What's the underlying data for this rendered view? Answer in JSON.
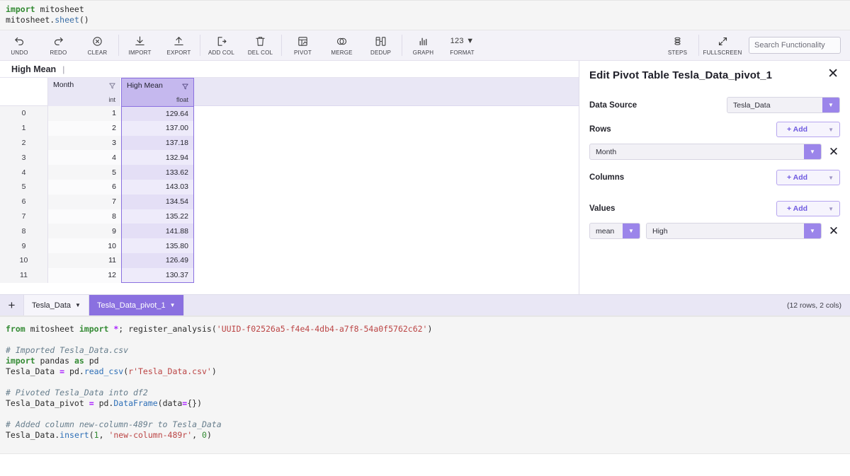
{
  "top_cell": {
    "line1_kw": "import",
    "line1_mod": " mitosheet",
    "line2_a": "mitosheet.",
    "line2_fn": "sheet",
    "line2_b": "()"
  },
  "toolbar": {
    "items": [
      {
        "label": "UNDO",
        "icon": "undo-icon"
      },
      {
        "label": "REDO",
        "icon": "redo-icon"
      },
      {
        "label": "CLEAR",
        "icon": "clear-icon"
      },
      {
        "label": "IMPORT",
        "icon": "import-icon"
      },
      {
        "label": "EXPORT",
        "icon": "export-icon"
      },
      {
        "label": "ADD COL",
        "icon": "add-column-icon"
      },
      {
        "label": "DEL COL",
        "icon": "delete-column-icon"
      },
      {
        "label": "PIVOT",
        "icon": "pivot-icon"
      },
      {
        "label": "MERGE",
        "icon": "merge-icon"
      },
      {
        "label": "DEDUP",
        "icon": "dedup-icon"
      },
      {
        "label": "GRAPH",
        "icon": "graph-icon"
      },
      {
        "label": "FORMAT",
        "icon": "format-number-icon",
        "icon_text": "123 ▼"
      },
      {
        "label": "STEPS",
        "icon": "steps-icon"
      },
      {
        "label": "FULLSCREEN",
        "icon": "fullscreen-icon"
      }
    ],
    "search_placeholder": "Search Functionality"
  },
  "formula_bar": {
    "cell_name": "High Mean"
  },
  "grid": {
    "columns": [
      {
        "name": "Month",
        "dtype": "int",
        "selected": false
      },
      {
        "name": "High Mean",
        "dtype": "float",
        "selected": true
      }
    ],
    "rows": [
      {
        "index": "0",
        "month": "1",
        "high_mean": "129.64"
      },
      {
        "index": "1",
        "month": "2",
        "high_mean": "137.00"
      },
      {
        "index": "2",
        "month": "3",
        "high_mean": "137.18"
      },
      {
        "index": "3",
        "month": "4",
        "high_mean": "132.94"
      },
      {
        "index": "4",
        "month": "5",
        "high_mean": "133.62"
      },
      {
        "index": "5",
        "month": "6",
        "high_mean": "143.03"
      },
      {
        "index": "6",
        "month": "7",
        "high_mean": "134.54"
      },
      {
        "index": "7",
        "month": "8",
        "high_mean": "135.22"
      },
      {
        "index": "8",
        "month": "9",
        "high_mean": "141.88"
      },
      {
        "index": "9",
        "month": "10",
        "high_mean": "135.80"
      },
      {
        "index": "10",
        "month": "11",
        "high_mean": "126.49"
      },
      {
        "index": "11",
        "month": "12",
        "high_mean": "130.37"
      }
    ]
  },
  "taskpane": {
    "title": "Edit Pivot Table Tesla_Data_pivot_1",
    "close_label": "✕",
    "data_source_label": "Data Source",
    "data_source_value": "Tesla_Data",
    "rows_label": "Rows",
    "rows_add_label": "+ Add",
    "rows_fields": [
      {
        "value": "Month"
      }
    ],
    "columns_label": "Columns",
    "columns_add_label": "+ Add",
    "values_label": "Values",
    "values_add_label": "+ Add",
    "values_fields": [
      {
        "agg": "mean",
        "column": "High"
      }
    ],
    "remove_label": "✕"
  },
  "tabbar": {
    "add_label": "+",
    "tabs": [
      {
        "label": "Tesla_Data",
        "active": false
      },
      {
        "label": "Tesla_Data_pivot_1",
        "active": true
      }
    ],
    "info": "(12 rows, 2 cols)"
  },
  "bottom_cell": {
    "l1_kw1": "from",
    "l1_mod": " mitosheet ",
    "l1_kw2": "import",
    "l1_star": " *",
    "l1_semi": "; register_analysis(",
    "l1_uuid": "'UUID-f02526a5-f4e4-4db4-a7f8-54a0f5762c62'",
    "l1_end": ")",
    "l2_cmt": "# Imported Tesla_Data.csv",
    "l3_kw": "import",
    "l3_rest": " pandas ",
    "l3_kw2": "as",
    "l3_rest2": " pd",
    "l4_a": "Tesla_Data ",
    "l4_eq": "=",
    "l4_b": " pd.",
    "l4_fn": "read_csv",
    "l4_c": "(",
    "l4_str": "r'Tesla_Data.csv'",
    "l4_d": ")",
    "l5_cmt": "# Pivoted Tesla_Data into df2",
    "l6_a": "Tesla_Data_pivot ",
    "l6_eq": "=",
    "l6_b": " pd.",
    "l6_fn": "DataFrame",
    "l6_c": "(data",
    "l6_eq2": "=",
    "l6_d": "{})",
    "l7_cmt": "# Added column new-column-489r to Tesla_Data",
    "l8_a": "Tesla_Data.",
    "l8_fn": "insert",
    "l8_b": "(",
    "l8_n1": "1",
    "l8_c": ", ",
    "l8_str": "'new-column-489r'",
    "l8_d": ", ",
    "l8_n2": "0",
    "l8_e": ")"
  },
  "colors": {
    "accent": "#8a70e0",
    "accent_light": "#9b85ea",
    "header_purple": "#c5b8ee",
    "grid_header": "#e9e7f5"
  }
}
